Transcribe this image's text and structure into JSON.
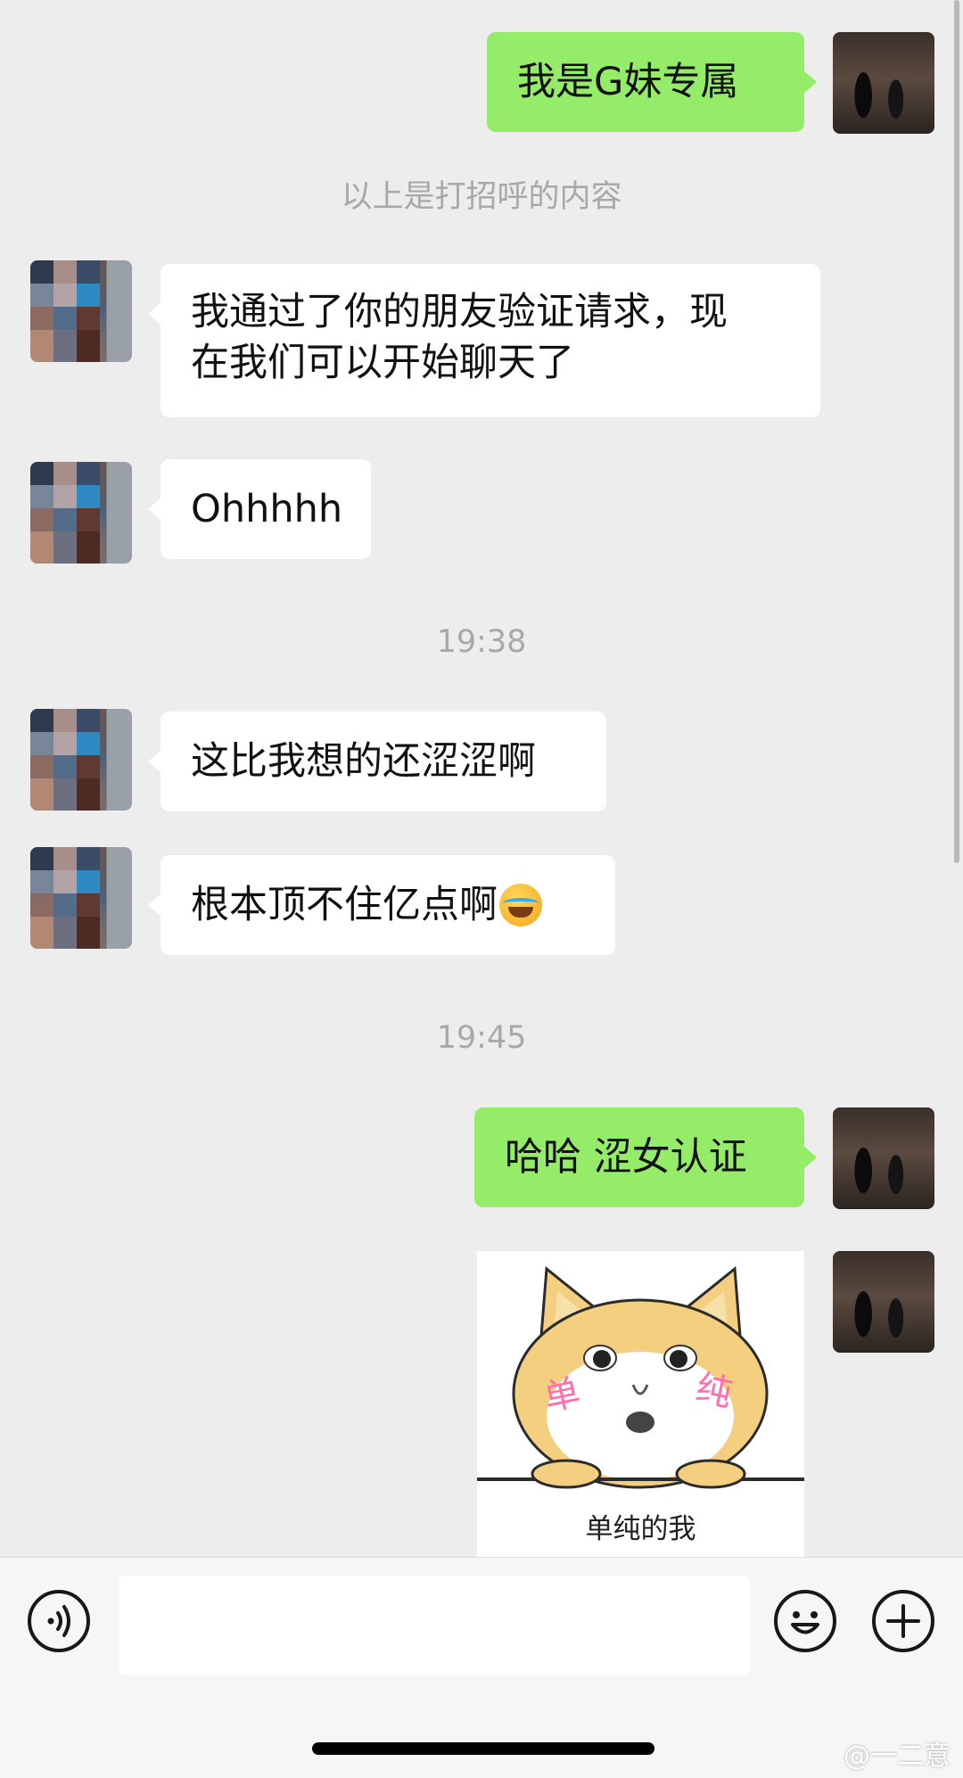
{
  "messages": [
    {
      "side": "right",
      "text": "我是G妹专属"
    },
    {
      "side": "left",
      "lines": [
        "我通过了你的朋友验证请求，现",
        "在我们可以开始聊天了"
      ]
    },
    {
      "side": "left",
      "text": "Ohhhhh"
    },
    {
      "side": "left",
      "text": "这比我想的还涩涩啊"
    },
    {
      "side": "left",
      "text": "根本顶不住亿点啊",
      "emoji": "face-with-tears-of-joy-icon"
    },
    {
      "side": "right",
      "text": "哈哈 涩女认证"
    },
    {
      "side": "right",
      "type": "sticker",
      "caption": "单纯的我",
      "face_text": [
        "单",
        "纯"
      ]
    }
  ],
  "system": {
    "greeting_note": "以上是打招呼的内容",
    "time1": "19:38",
    "time2": "19:45"
  },
  "input_bar": {
    "voice_icon": "voice-icon",
    "emoji_icon": "emoji-icon",
    "plus_icon": "plus-icon",
    "input_value": ""
  },
  "watermark": "@一二意",
  "colors": {
    "sent_bubble": "#95ec69",
    "received_bubble": "#ffffff",
    "background": "#ededed"
  }
}
